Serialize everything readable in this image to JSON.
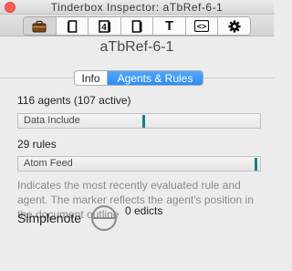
{
  "window": {
    "title": "Tinderbox Inspector: aTbRef-6-1"
  },
  "toolbar": {
    "tabs": [
      {
        "icon": "briefcase-icon",
        "active": true
      },
      {
        "icon": "text-page-icon",
        "active": false
      },
      {
        "icon": "page-4-icon",
        "label": "4",
        "active": false
      },
      {
        "icon": "page-icon",
        "active": false
      },
      {
        "icon": "text-t-icon",
        "label": "T",
        "active": false
      },
      {
        "icon": "code-brackets-icon",
        "label": "<>",
        "active": false
      },
      {
        "icon": "gear-icon",
        "active": false
      }
    ]
  },
  "note": {
    "title": "aTbRef-6-1"
  },
  "tabs": {
    "info": "Info",
    "agents_rules": "Agents & Rules",
    "selected": "agents_rules"
  },
  "agents": {
    "summary": "116 agents (107 active)",
    "current": "Data Include",
    "position": 0.52
  },
  "rules": {
    "summary": "29 rules",
    "current": "Atom Feed",
    "position": 0.99
  },
  "description": "Indicates the most recently evaluated rule and agent. The marker reflects the agent's position in the document outline",
  "simplenote": {
    "label": "Simplenote",
    "edicts": "0 edicts"
  },
  "colors": {
    "accent": "#2c8cf8",
    "marker": "#16807f",
    "close": "#fc5f57"
  }
}
